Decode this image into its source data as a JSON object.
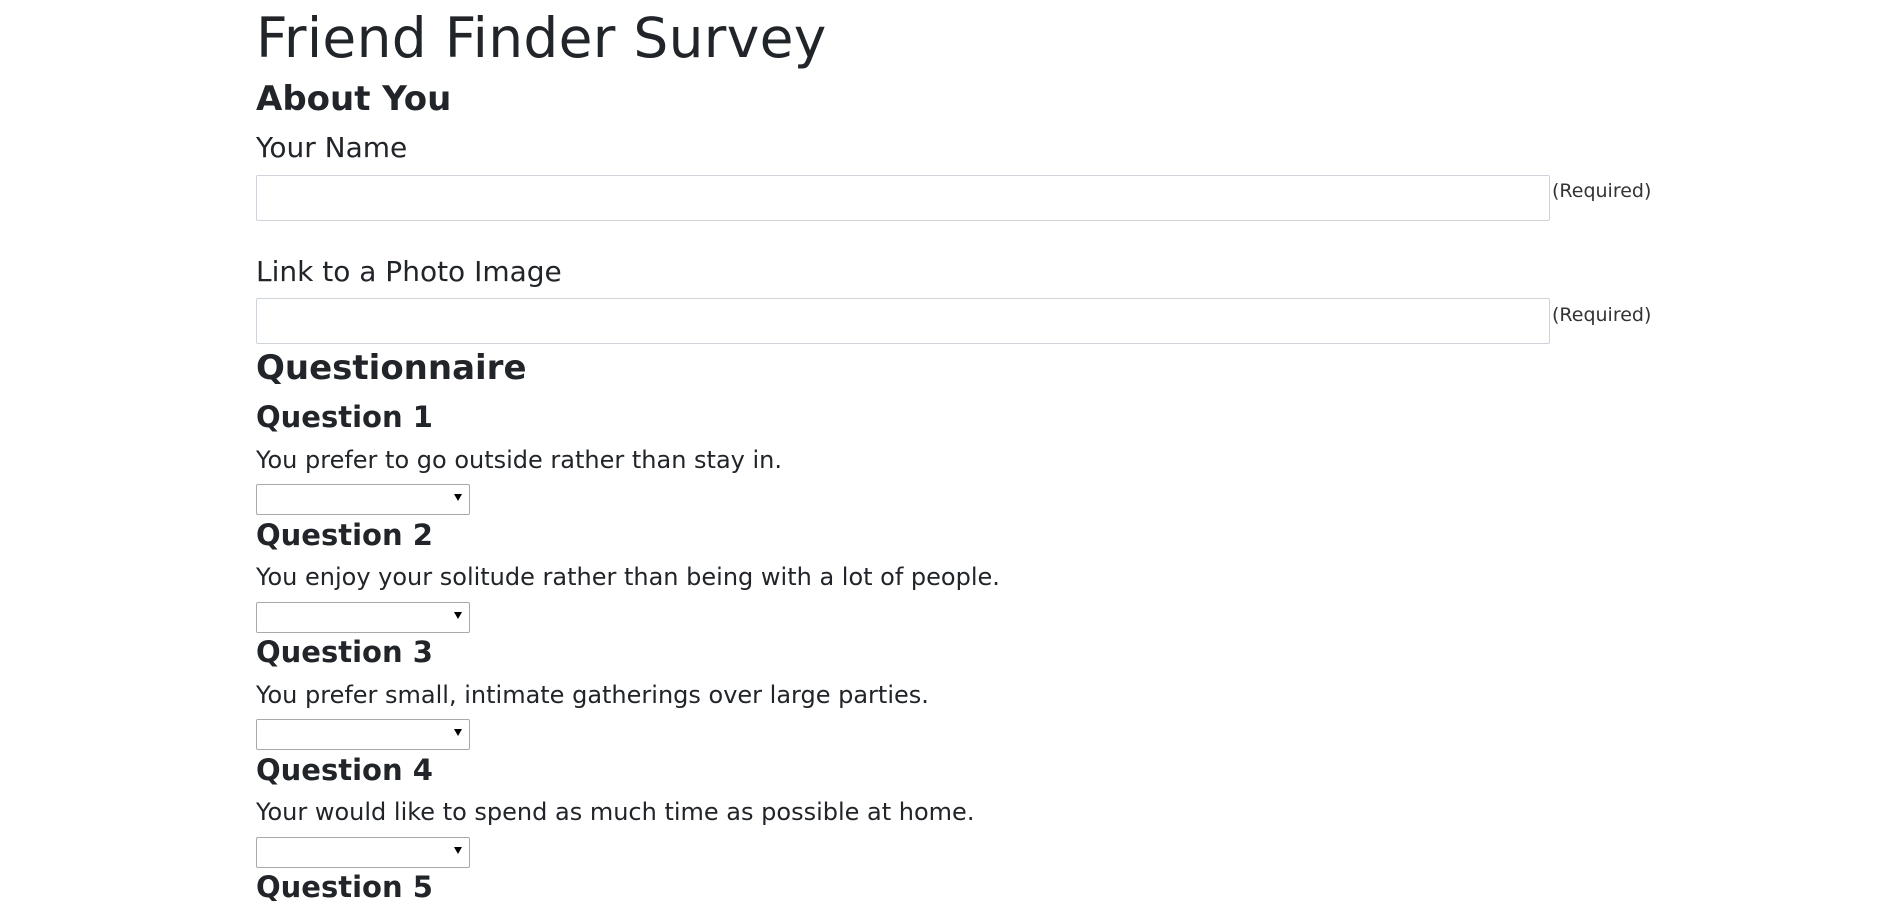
{
  "page": {
    "title": "Friend Finder Survey"
  },
  "about": {
    "heading": "About You",
    "name_label": "Your Name",
    "name_value": "",
    "name_required": "(Required)",
    "photo_label": "Link to a Photo Image",
    "photo_value": "",
    "photo_required": "(Required)"
  },
  "questionnaire": {
    "heading": "Questionnaire",
    "questions": [
      {
        "title": "Question 1",
        "text": "You prefer to go outside rather than stay in.",
        "selected": ""
      },
      {
        "title": "Question 2",
        "text": "You enjoy your solitude rather than being with a lot of people.",
        "selected": ""
      },
      {
        "title": "Question 3",
        "text": "You prefer small, intimate gatherings over large parties.",
        "selected": ""
      },
      {
        "title": "Question 4",
        "text": "Your would like to spend as much time as possible at home.",
        "selected": ""
      },
      {
        "title": "Question 5"
      }
    ]
  },
  "icons": {
    "select_arrow": "chevron-down-icon"
  }
}
